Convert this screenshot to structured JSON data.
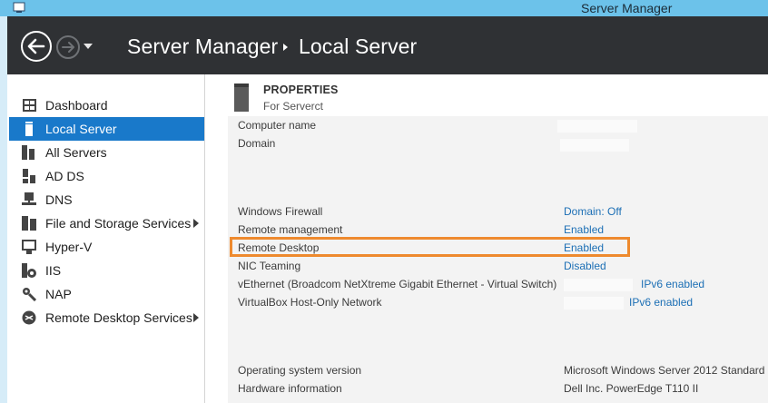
{
  "window": {
    "title": "Server Manager"
  },
  "header": {
    "breadcrumb_root": "Server Manager",
    "breadcrumb_current": "Local Server"
  },
  "sidebar": {
    "items": [
      {
        "label": "Dashboard",
        "icon": "dashboard-icon"
      },
      {
        "label": "Local Server",
        "icon": "server-icon",
        "active": true
      },
      {
        "label": "All Servers",
        "icon": "servers-icon"
      },
      {
        "label": "AD DS",
        "icon": "ad-ds-icon"
      },
      {
        "label": "DNS",
        "icon": "dns-icon"
      },
      {
        "label": "File and Storage Services",
        "icon": "file-storage-icon",
        "has_submenu": true
      },
      {
        "label": "Hyper-V",
        "icon": "hyper-v-icon"
      },
      {
        "label": "IIS",
        "icon": "iis-icon"
      },
      {
        "label": "NAP",
        "icon": "nap-icon"
      },
      {
        "label": "Remote Desktop Services",
        "icon": "remote-desktop-icon",
        "has_submenu": true
      }
    ]
  },
  "properties": {
    "title": "PROPERTIES",
    "subtitle": "For Serverct",
    "rows": [
      {
        "label": "Computer name",
        "value": ""
      },
      {
        "label": "Domain",
        "value": ""
      },
      {
        "label": "Windows Firewall",
        "value": "Domain: Off"
      },
      {
        "label": "Remote management",
        "value": "Enabled"
      },
      {
        "label": "Remote Desktop",
        "value": "Enabled"
      },
      {
        "label": "NIC Teaming",
        "value": "Disabled"
      },
      {
        "label": "vEthernet (Broadcom NetXtreme Gigabit Ethernet - Virtual Switch)",
        "value": "IPv6 enabled"
      },
      {
        "label": "VirtualBox Host-Only Network",
        "value": "IPv6 enabled"
      },
      {
        "label": "Operating system version",
        "value": "Microsoft Windows Server 2012 Standard"
      },
      {
        "label": "Hardware information",
        "value": "Dell Inc. PowerEdge T110 II"
      }
    ]
  },
  "colors": {
    "header_bg": "#2f3134",
    "active_item": "#1979ca",
    "link": "#1c6fb5",
    "highlight": "#ee8a2e",
    "titlebar": "#6cc2ea"
  }
}
